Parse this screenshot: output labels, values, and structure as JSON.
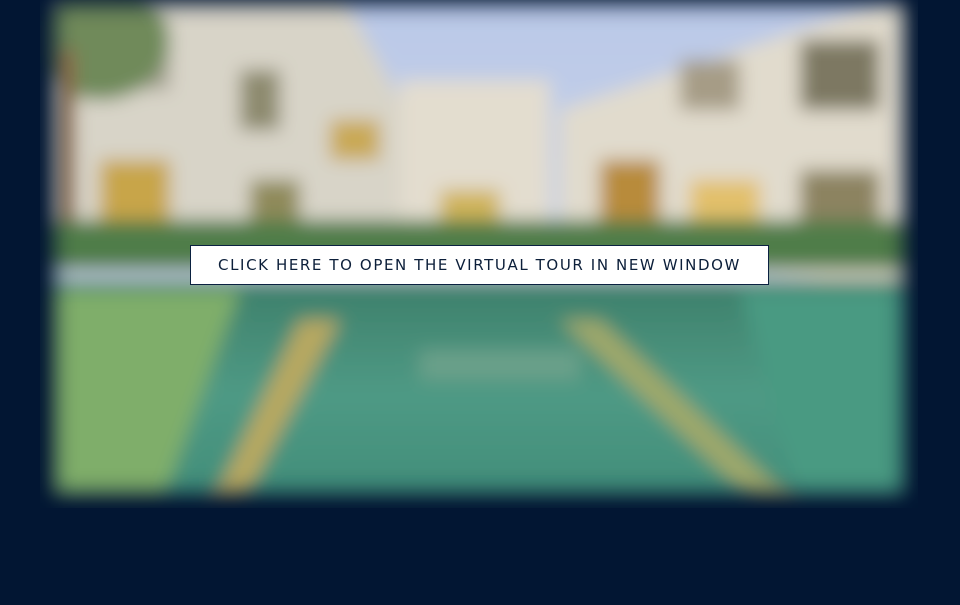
{
  "tour": {
    "open_button_label": "CLICK HERE TO OPEN THE VIRTUAL TOUR IN NEW WINDOW"
  },
  "colors": {
    "page_background": "#021633",
    "button_background": "#ffffff",
    "button_text": "#0c1f3a"
  }
}
